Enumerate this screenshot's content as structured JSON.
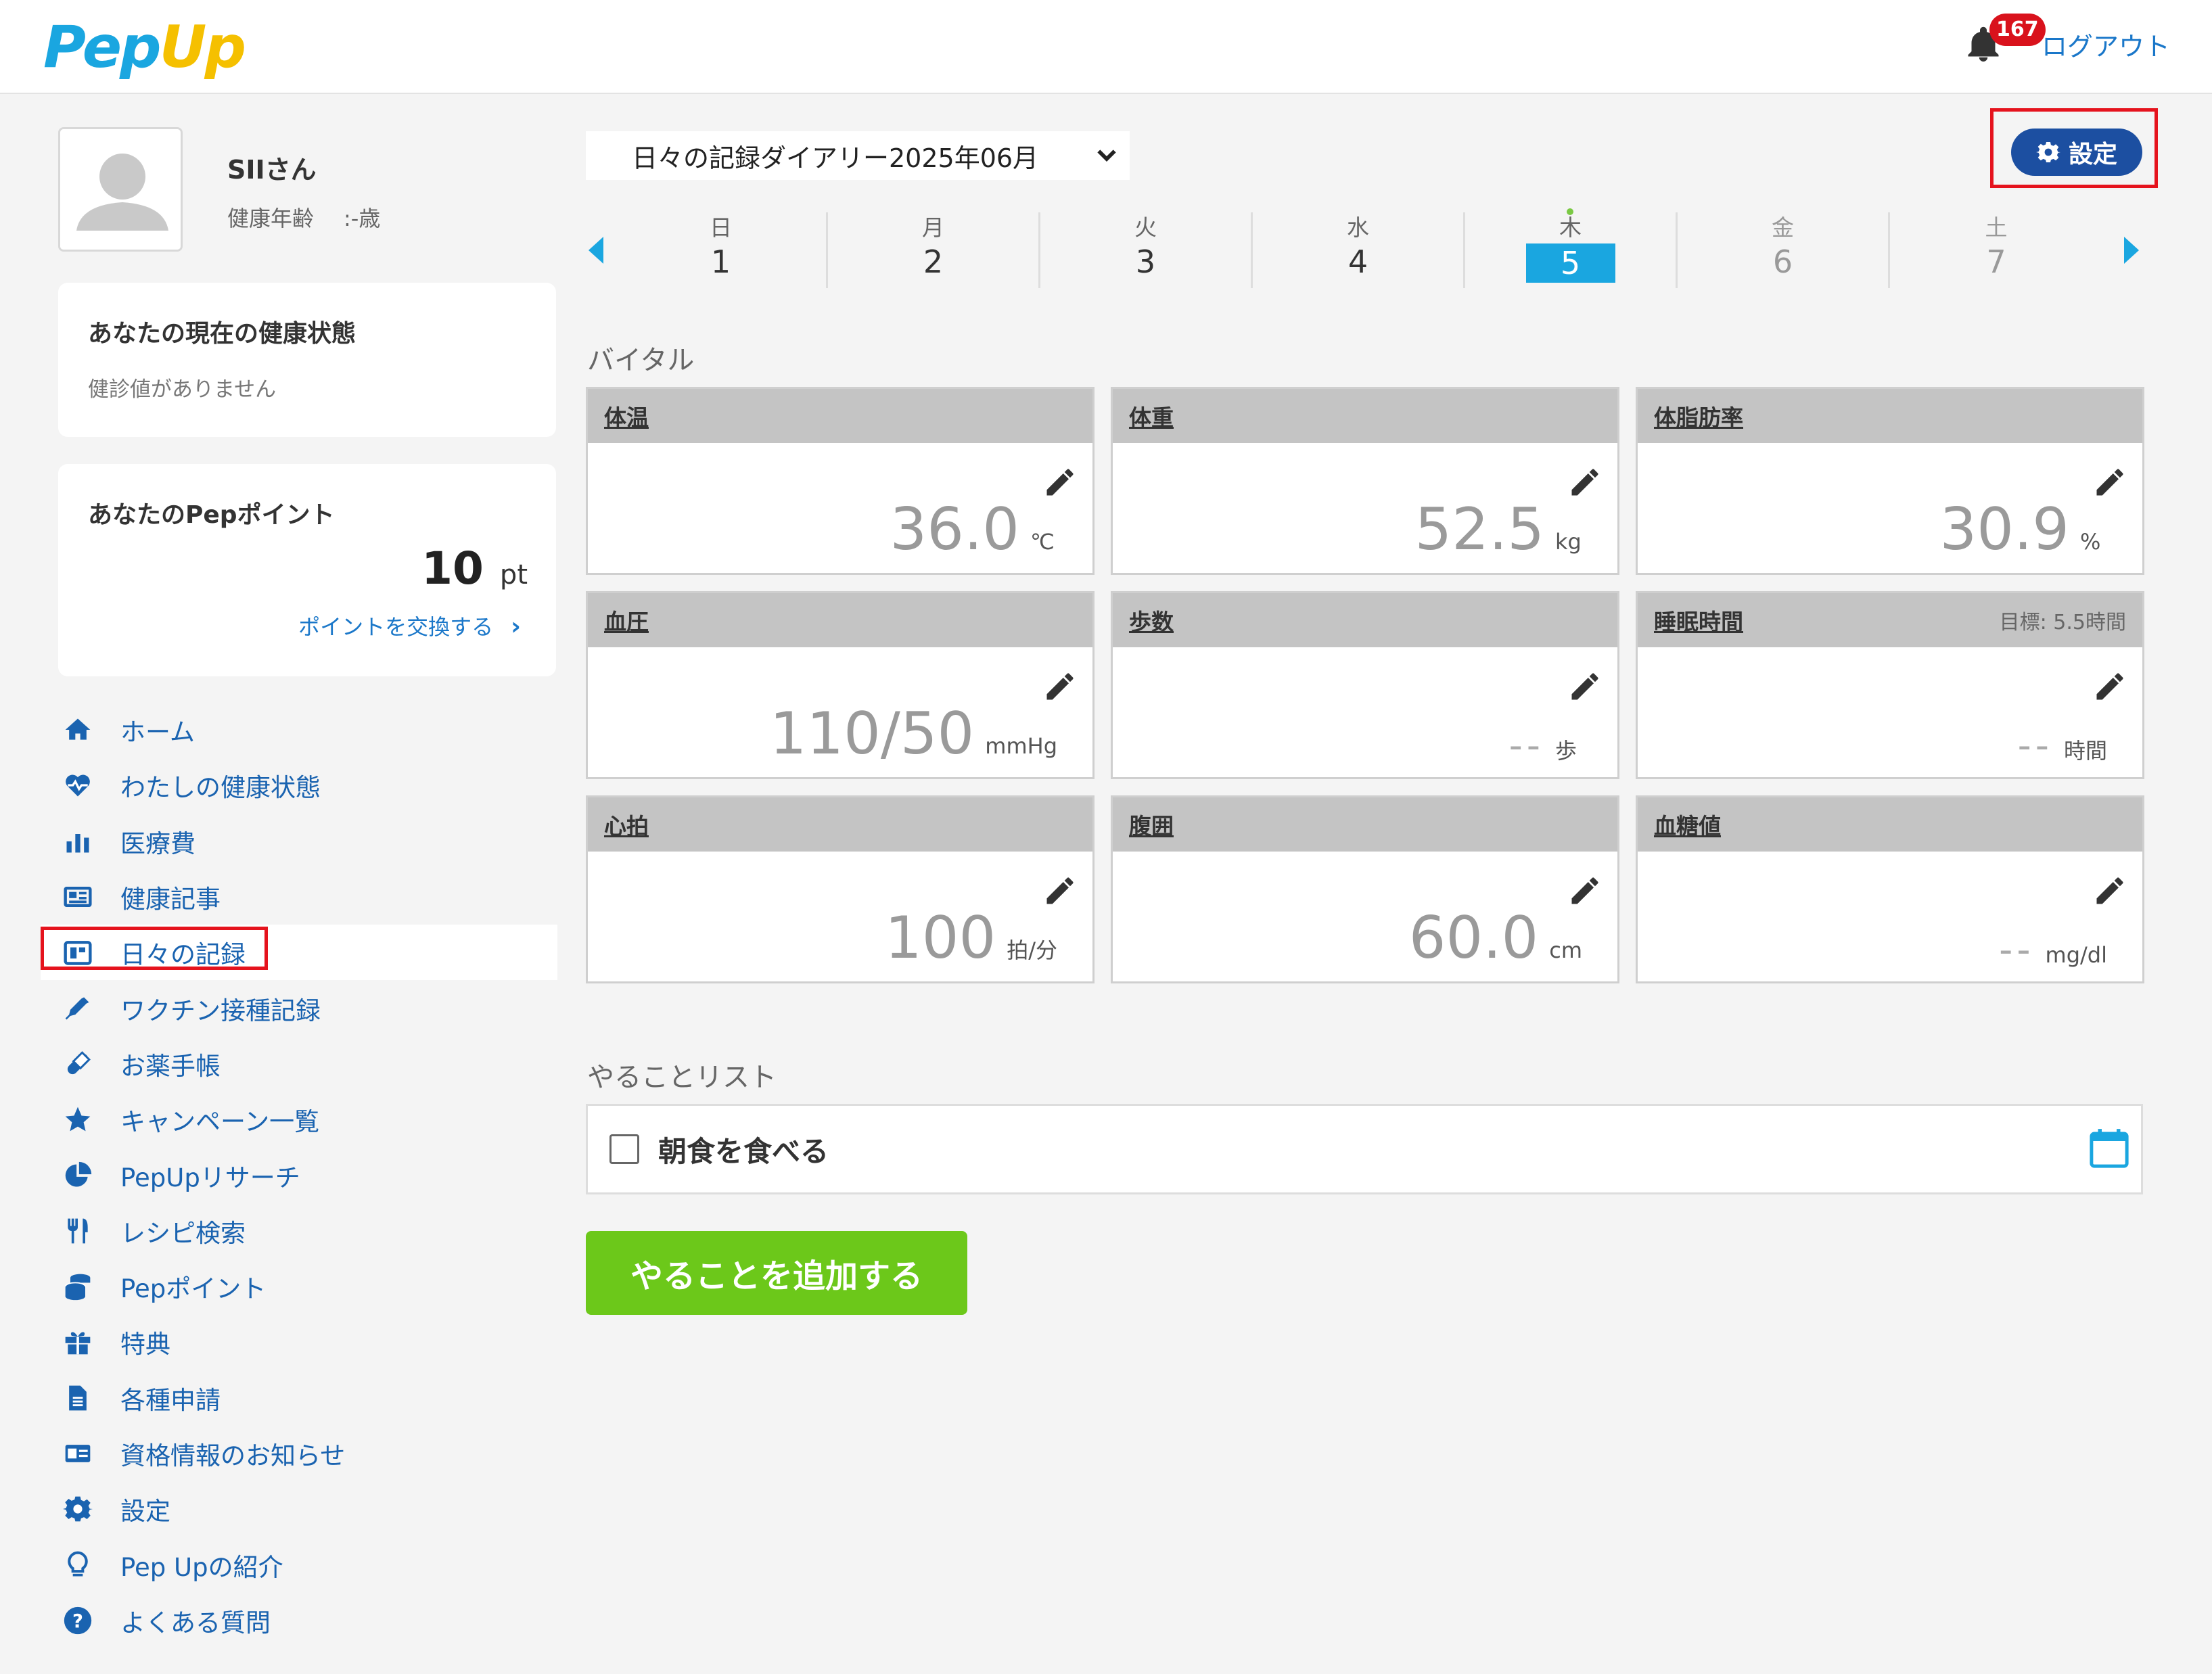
{
  "header": {
    "logo_pep": "Pep",
    "logo_up": "Up",
    "notification_count": "167",
    "logout_label": "ログアウト"
  },
  "profile": {
    "name": "SIIさん",
    "health_age_label": "健康年齢",
    "health_age_value": ":-歳"
  },
  "health_status": {
    "title": "あなたの現在の健康状態",
    "message": "健診値がありません"
  },
  "points": {
    "title": "あなたのPepポイント",
    "value": "10",
    "unit": "pt",
    "exchange_label": "ポイントを交換する",
    "exchange_arrow": "›"
  },
  "sidebar": {
    "items": [
      {
        "label": "ホーム",
        "icon": "home-icon"
      },
      {
        "label": "わたしの健康状態",
        "icon": "heart-pulse-icon"
      },
      {
        "label": "医療費",
        "icon": "bar-chart-icon"
      },
      {
        "label": "健康記事",
        "icon": "newspaper-icon"
      },
      {
        "label": "日々の記録",
        "icon": "calendar-icon"
      },
      {
        "label": "ワクチン接種記録",
        "icon": "syringe-icon"
      },
      {
        "label": "お薬手帳",
        "icon": "pill-icon"
      },
      {
        "label": "キャンペーン一覧",
        "icon": "star-icon"
      },
      {
        "label": "PepUpリサーチ",
        "icon": "pie-chart-icon"
      },
      {
        "label": "レシピ検索",
        "icon": "utensils-icon"
      },
      {
        "label": "Pepポイント",
        "icon": "coins-icon"
      },
      {
        "label": "特典",
        "icon": "gift-icon"
      },
      {
        "label": "各種申請",
        "icon": "document-icon"
      },
      {
        "label": "資格情報のお知らせ",
        "icon": "id-card-icon"
      },
      {
        "label": "設定",
        "icon": "gear-icon"
      },
      {
        "label": "Pep Upの紹介",
        "icon": "lightbulb-icon"
      },
      {
        "label": "よくある質問",
        "icon": "question-icon"
      }
    ]
  },
  "diary": {
    "selected": "日々の記録ダイアリー2025年06月",
    "settings_label": "設定"
  },
  "week": {
    "days": [
      {
        "name": "日",
        "date": "1"
      },
      {
        "name": "月",
        "date": "2"
      },
      {
        "name": "火",
        "date": "3"
      },
      {
        "name": "水",
        "date": "4"
      },
      {
        "name": "木",
        "date": "5"
      },
      {
        "name": "金",
        "date": "6"
      },
      {
        "name": "土",
        "date": "7"
      }
    ]
  },
  "vitals": {
    "title": "バイタル",
    "cards": [
      {
        "name": "体温",
        "value": "36.0",
        "unit": "℃",
        "goal": ""
      },
      {
        "name": "体重",
        "value": "52.5",
        "unit": "kg",
        "goal": ""
      },
      {
        "name": "体脂肪率",
        "value": "30.9",
        "unit": "%",
        "goal": ""
      },
      {
        "name": "血圧",
        "value": "110/50",
        "unit": "mmHg",
        "goal": ""
      },
      {
        "name": "歩数",
        "value": "--",
        "unit": "歩",
        "goal": ""
      },
      {
        "name": "睡眠時間",
        "value": "--",
        "unit": "時間",
        "goal": "目標: 5.5時間"
      },
      {
        "name": "心拍",
        "value": "100",
        "unit": "拍/分",
        "goal": ""
      },
      {
        "name": "腹囲",
        "value": "60.0",
        "unit": "cm",
        "goal": ""
      },
      {
        "name": "血糖値",
        "value": "--",
        "unit": "mg/dl",
        "goal": ""
      }
    ]
  },
  "todo": {
    "title": "やることリスト",
    "items": [
      {
        "label": "朝食を食べる"
      }
    ],
    "add_label": "やることを追加する"
  },
  "colors": {
    "brand_blue": "#1aa6e0",
    "link_blue": "#1a63b0",
    "settings_navy": "#1c4fa1",
    "add_green": "#6cc81a",
    "highlight_red": "#e5131d"
  }
}
